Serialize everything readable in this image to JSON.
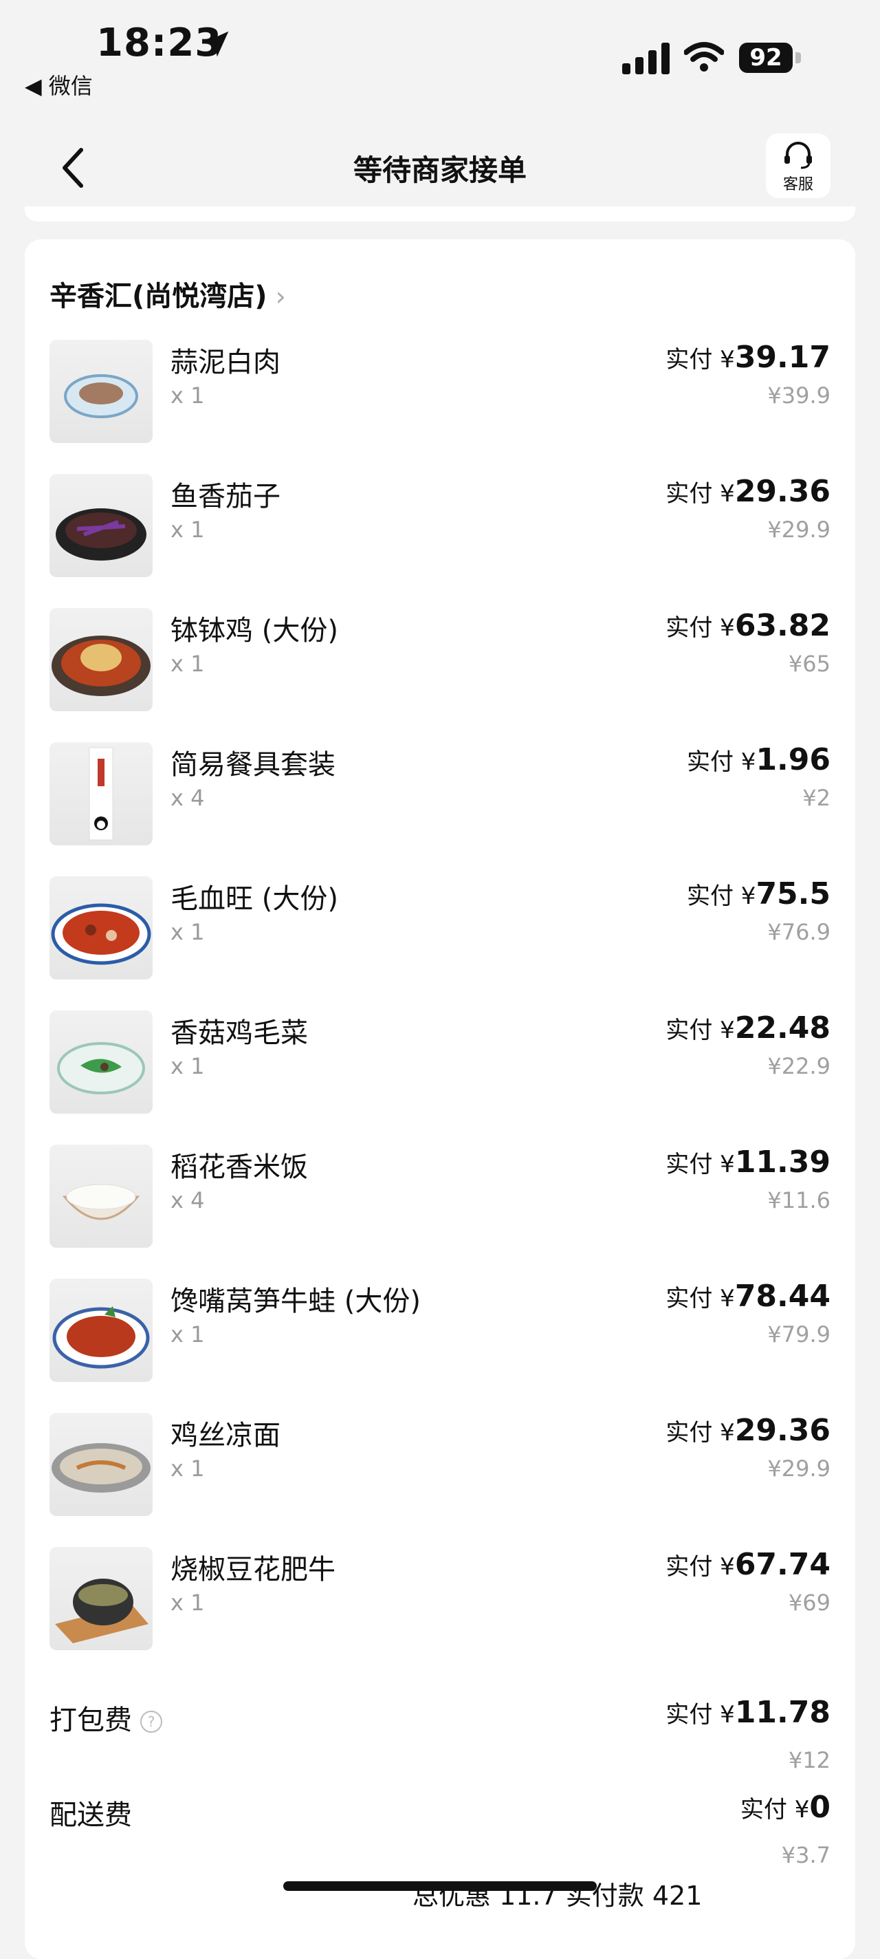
{
  "status_bar": {
    "time": "18:23",
    "back_app": "◀ 微信",
    "battery": "92"
  },
  "header": {
    "title": "等待商家接单",
    "service_label": "客服"
  },
  "shop": {
    "name": "辛香汇(尚悦湾店)"
  },
  "labels": {
    "paid_prefix": "实付 ¥"
  },
  "items": [
    {
      "name": "蒜泥白肉",
      "qty": "x 1",
      "paid": "39.17",
      "original": "¥39.9"
    },
    {
      "name": "鱼香茄子",
      "qty": "x 1",
      "paid": "29.36",
      "original": "¥29.9"
    },
    {
      "name": "钵钵鸡 (大份)",
      "qty": "x 1",
      "paid": "63.82",
      "original": "¥65"
    },
    {
      "name": "简易餐具套装",
      "qty": "x 4",
      "paid": "1.96",
      "original": "¥2"
    },
    {
      "name": "毛血旺 (大份)",
      "qty": "x 1",
      "paid": "75.5",
      "original": "¥76.9"
    },
    {
      "name": "香菇鸡毛菜",
      "qty": "x 1",
      "paid": "22.48",
      "original": "¥22.9"
    },
    {
      "name": "稻花香米饭",
      "qty": "x 4",
      "paid": "11.39",
      "original": "¥11.6"
    },
    {
      "name": "馋嘴莴笋牛蛙 (大份)",
      "qty": "x 1",
      "paid": "78.44",
      "original": "¥79.9"
    },
    {
      "name": "鸡丝凉面",
      "qty": "x 1",
      "paid": "29.36",
      "original": "¥29.9"
    },
    {
      "name": "烧椒豆花肥牛",
      "qty": "x 1",
      "paid": "67.74",
      "original": "¥69"
    }
  ],
  "fees": [
    {
      "label": "打包费",
      "paid": "11.78",
      "original": "¥12"
    },
    {
      "label": "配送费",
      "paid": "0",
      "original": "¥3.7"
    }
  ],
  "summary": {
    "text": "总优惠 11.7  实付款 421"
  }
}
